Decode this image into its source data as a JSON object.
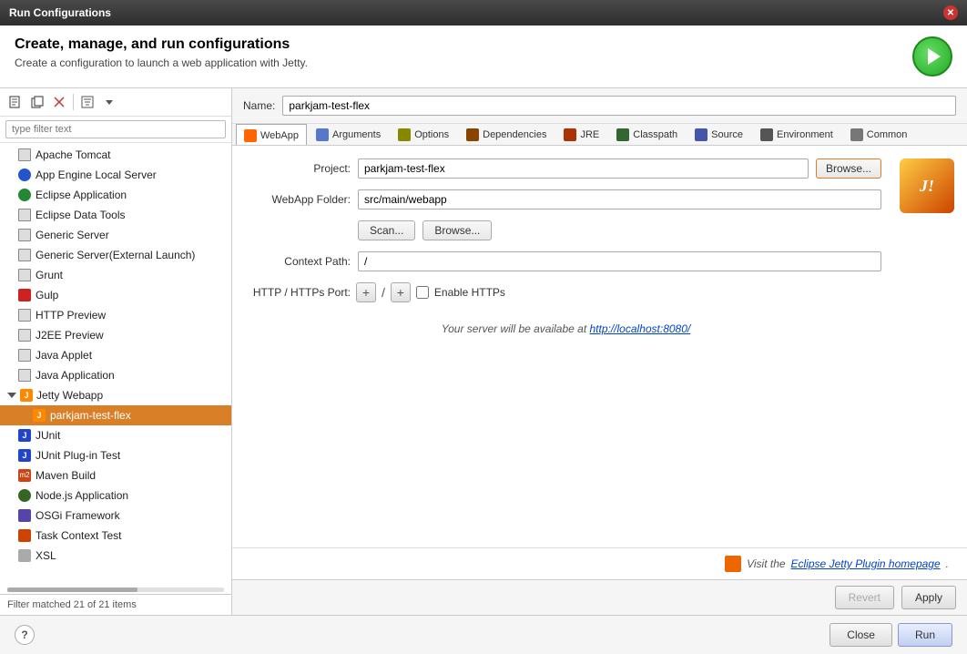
{
  "titleBar": {
    "title": "Run Configurations"
  },
  "header": {
    "heading": "Create, manage, and run configurations",
    "subtext": "Create a configuration to launch a web application with Jetty."
  },
  "leftPanel": {
    "filterPlaceholder": "type filter text",
    "items": [
      {
        "id": "apache-tomcat",
        "label": "Apache Tomcat",
        "indent": "indent1",
        "icon": "square"
      },
      {
        "id": "app-engine",
        "label": "App Engine Local Server",
        "indent": "indent1",
        "icon": "circle-blue"
      },
      {
        "id": "eclipse-app",
        "label": "Eclipse Application",
        "indent": "indent1",
        "icon": "circle-green"
      },
      {
        "id": "eclipse-data",
        "label": "Eclipse Data Tools",
        "indent": "indent1",
        "icon": "square"
      },
      {
        "id": "generic-server",
        "label": "Generic Server",
        "indent": "indent1",
        "icon": "square"
      },
      {
        "id": "generic-server-ext",
        "label": "Generic Server(External Launch)",
        "indent": "indent1",
        "icon": "square"
      },
      {
        "id": "grunt",
        "label": "Grunt",
        "indent": "indent1",
        "icon": "square"
      },
      {
        "id": "gulp",
        "label": "Gulp",
        "indent": "indent1",
        "icon": "red-square"
      },
      {
        "id": "http-preview",
        "label": "HTTP Preview",
        "indent": "indent1",
        "icon": "square"
      },
      {
        "id": "j2ee-preview",
        "label": "J2EE Preview",
        "indent": "indent1",
        "icon": "square"
      },
      {
        "id": "java-applet",
        "label": "Java Applet",
        "indent": "indent1",
        "icon": "square"
      },
      {
        "id": "java-application",
        "label": "Java Application",
        "indent": "indent1",
        "icon": "square"
      },
      {
        "id": "jetty-webapp",
        "label": "Jetty Webapp",
        "indent": "indent1",
        "icon": "orange-j",
        "expanded": true
      },
      {
        "id": "parkjam-test-flex",
        "label": "parkjam-test-flex",
        "indent": "indent2",
        "icon": "orange-j",
        "selected": true
      },
      {
        "id": "junit",
        "label": "JUnit",
        "indent": "indent1",
        "icon": "orange-j"
      },
      {
        "id": "junit-plugin",
        "label": "JUnit Plug-in Test",
        "indent": "indent1",
        "icon": "orange-j"
      },
      {
        "id": "maven-build",
        "label": "Maven Build",
        "indent": "indent1",
        "icon": "maven"
      },
      {
        "id": "nodejs-app",
        "label": "Node.js Application",
        "indent": "indent1",
        "icon": "node"
      },
      {
        "id": "osgi-framework",
        "label": "OSGi Framework",
        "indent": "indent1",
        "icon": "osgi"
      },
      {
        "id": "task-context-test",
        "label": "Task Context Test",
        "indent": "indent1",
        "icon": "task"
      },
      {
        "id": "xsl",
        "label": "XSL",
        "indent": "indent1",
        "icon": "xsl"
      }
    ],
    "footer": "Filter matched 21 of 21 items"
  },
  "nameBar": {
    "label": "Name:",
    "value": "parkjam-test-flex"
  },
  "tabs": [
    {
      "id": "webapp",
      "label": "WebApp",
      "active": true
    },
    {
      "id": "arguments",
      "label": "Arguments",
      "active": false
    },
    {
      "id": "options",
      "label": "Options",
      "active": false
    },
    {
      "id": "dependencies",
      "label": "Dependencies",
      "active": false
    },
    {
      "id": "jre",
      "label": "JRE",
      "active": false
    },
    {
      "id": "classpath",
      "label": "Classpath",
      "active": false
    },
    {
      "id": "source",
      "label": "Source",
      "active": false
    },
    {
      "id": "environment",
      "label": "Environment",
      "active": false
    },
    {
      "id": "common",
      "label": "Common",
      "active": false
    }
  ],
  "webappForm": {
    "projectLabel": "Project:",
    "projectValue": "parkjam-test-flex",
    "browseLabel": "Browse...",
    "webappFolderLabel": "WebApp Folder:",
    "webappFolderValue": "src/main/webapp",
    "scanLabel": "Scan...",
    "browse2Label": "Browse...",
    "contextPathLabel": "Context Path:",
    "contextPathValue": "/",
    "portLabel": "HTTP / HTTPs Port:",
    "httpsLabel": "Enable HTTPs",
    "serverNotice": "Your server will be availabe at ",
    "serverLink": "http://localhost:8080/",
    "footerNotice": "Visit the ",
    "footerLink": "Eclipse Jetty Plugin homepage",
    "footerLinkSuffix": "."
  },
  "footer": {
    "revertLabel": "Revert",
    "applyLabel": "Apply",
    "closeLabel": "Close",
    "runLabel": "Run"
  }
}
